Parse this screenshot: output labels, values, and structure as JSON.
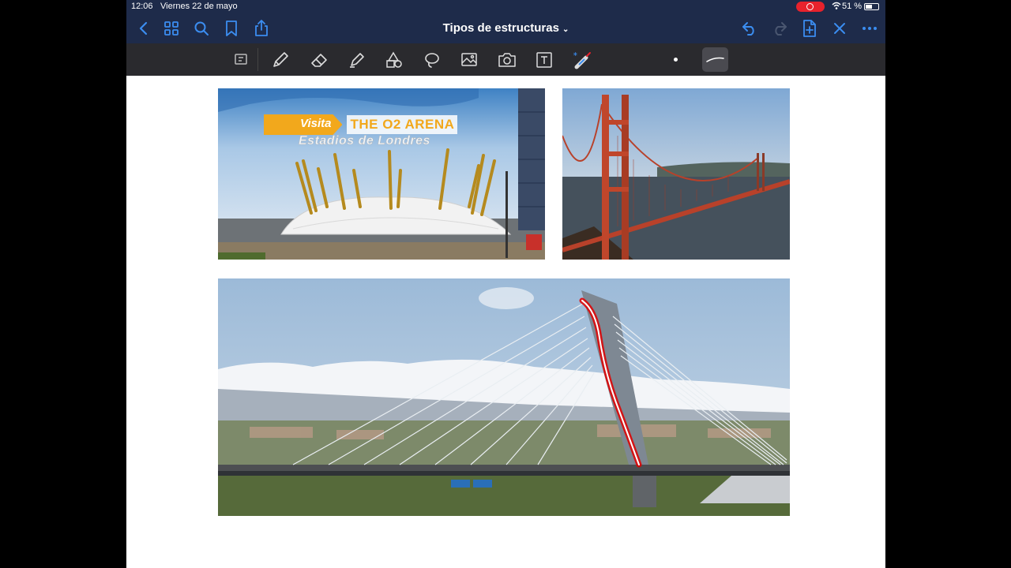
{
  "status_bar": {
    "time": "12:06",
    "date": "Viernes 22 de mayo",
    "battery": "51 %"
  },
  "nav": {
    "title": "Tipos de estructuras",
    "icons": [
      "back-icon",
      "grid-icon",
      "search-icon",
      "bookmark-icon",
      "share-icon",
      "undo-icon",
      "redo-icon",
      "add-page-icon",
      "close-icon",
      "more-icon"
    ]
  },
  "toolbar": {
    "tools": [
      "lasso-select-icon",
      "pen-icon",
      "eraser-icon",
      "highlighter-icon",
      "shapes-icon",
      "lasso-icon",
      "image-icon",
      "camera-icon",
      "text-icon",
      "laser-pointer-icon"
    ]
  },
  "images": {
    "o2_arena": {
      "visita": "Visita",
      "title": "THE O2 ARENA",
      "subtitle": "Estadios de Londres"
    }
  },
  "colors": {
    "nav_bg": "#1e2b4a",
    "toolbar_bg": "#2a2a2e",
    "accent_blue": "#3b8df0",
    "record_red": "#e8222c",
    "annotation_red": "#e10000"
  }
}
